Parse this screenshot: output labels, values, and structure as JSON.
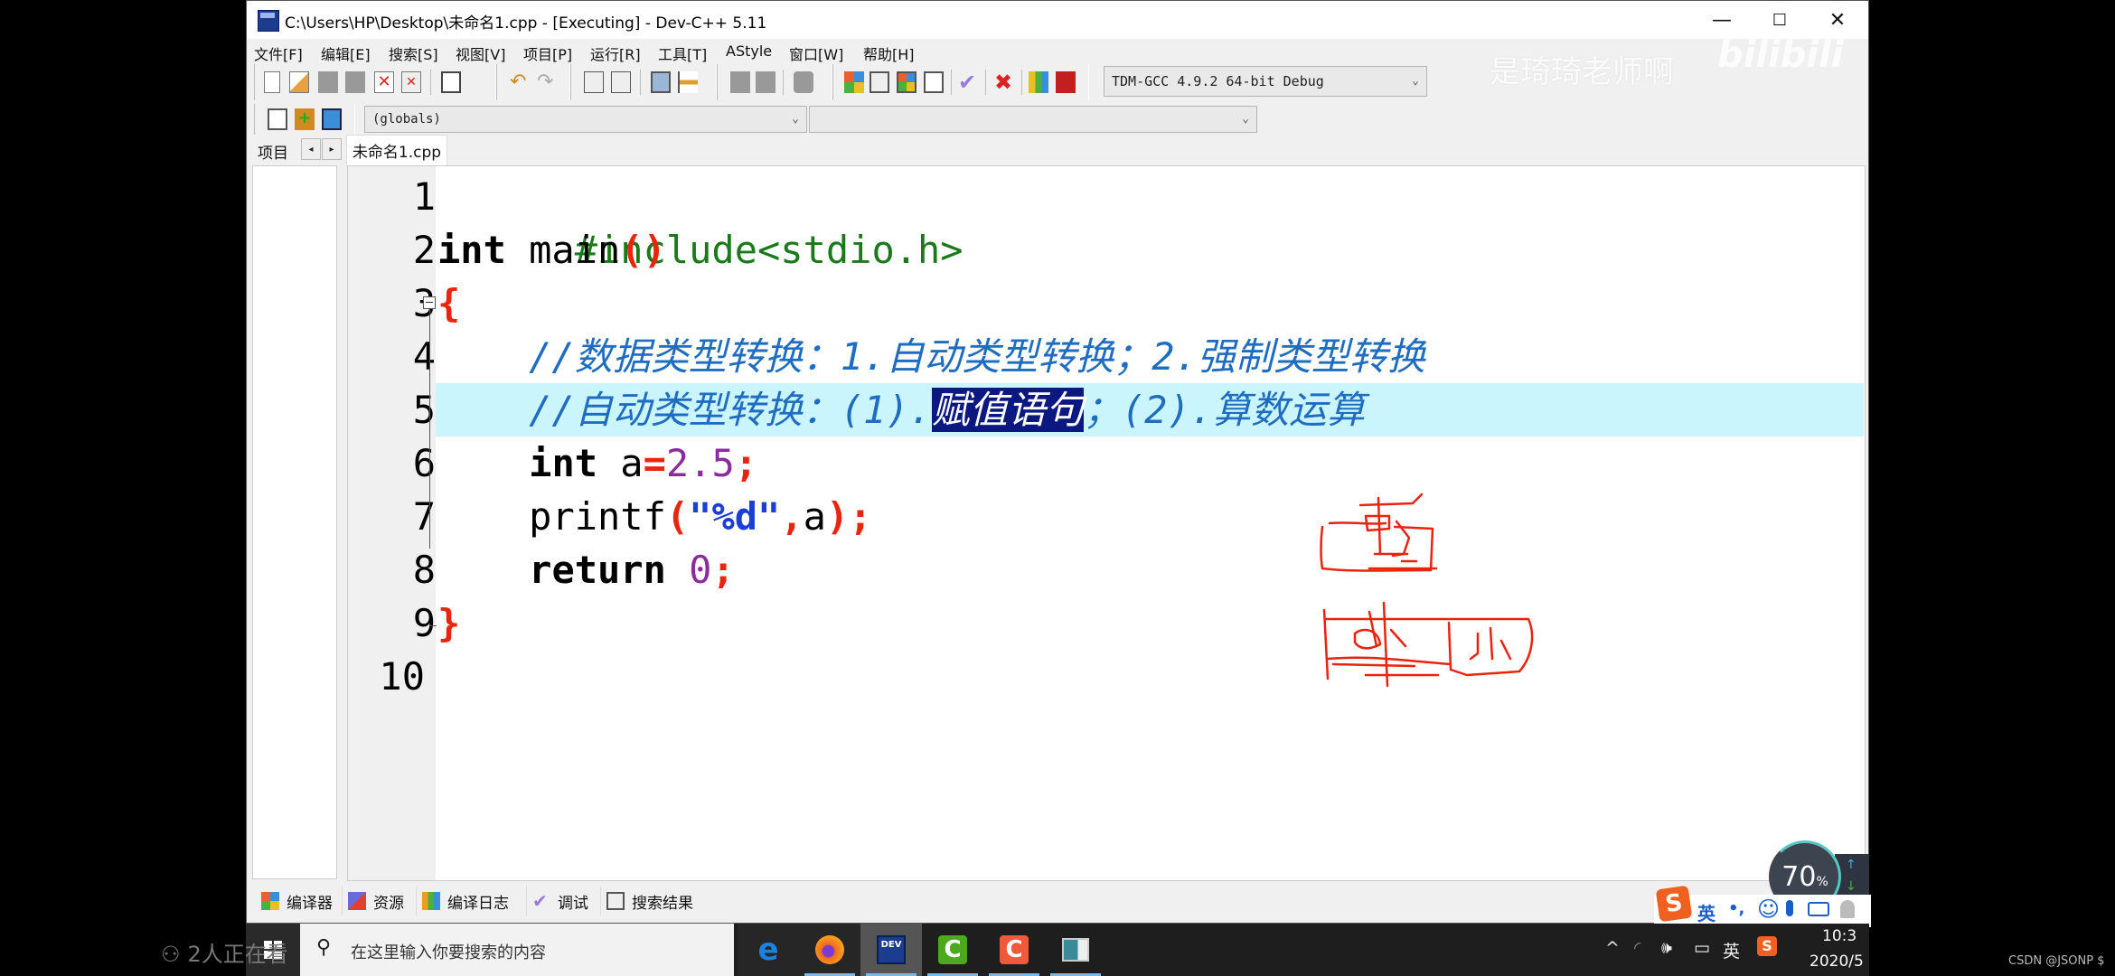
{
  "window": {
    "title": "C:\\Users\\HP\\Desktop\\未命名1.cpp - [Executing] - Dev-C++ 5.11",
    "controls": {
      "minimize": "—",
      "maximize": "☐",
      "close": "✕"
    }
  },
  "menu": [
    "文件[F]",
    "编辑[E]",
    "搜索[S]",
    "视图[V]",
    "项目[P]",
    "运行[R]",
    "工具[T]",
    "AStyle",
    "窗口[W]",
    "帮助[H]"
  ],
  "toolbar": {
    "compiler_select": "TDM-GCC 4.9.2 64-bit Debug",
    "scope_select": "(globals)",
    "member_select": ""
  },
  "left_panel": {
    "tab_label": "项目",
    "prev": "◂",
    "next": "▸"
  },
  "editor": {
    "file_tab": "未命名1.cpp",
    "line_numbers": [
      "1",
      "2",
      "3",
      "4",
      "5",
      "6",
      "7",
      "8",
      "9",
      "10"
    ],
    "highlighted_line": 5,
    "lines": {
      "l1": {
        "pp": "#include<stdio.h>"
      },
      "l2": {
        "kw": "int",
        "name": " main",
        "paren": "()"
      },
      "l3": {
        "brace": "{"
      },
      "l4": {
        "comment": "    //数据类型转换：1.自动类型转换；2.强制类型转换"
      },
      "l5": {
        "comment_a": "    //自动类型转换：(1).",
        "selected": "赋值语句",
        "comment_b": "；(2).算数运算"
      },
      "l6": {
        "indent": "    ",
        "kw": "int",
        "var": " a",
        "op": "=",
        "num": "2.5",
        "semi": ";"
      },
      "l7": {
        "indent": "    ",
        "fn": "printf",
        "lp": "(",
        "str": "\"%d\"",
        "comma": ",",
        "arg": "a",
        "rp": ")",
        "semi": ";"
      },
      "l8": {
        "indent": "    ",
        "kw": "return",
        "sp": " ",
        "num": "0",
        "semi": ";"
      },
      "l9": {
        "brace": "}"
      }
    }
  },
  "bottom_tabs": [
    "编译器",
    "资源",
    "编译日志",
    "调试",
    "搜索结果"
  ],
  "overlay": {
    "watermark": "是琦琦老师啊",
    "watermark_logo": "bilibili",
    "viewers": "2人正在看",
    "gauge_value": "70",
    "gauge_unit": "%",
    "csdn": "CSDN @JSONP $"
  },
  "ime": {
    "lang": "英",
    "punct": "•,",
    "items": [
      "☺",
      "🎤",
      "⌨"
    ]
  },
  "taskbar": {
    "search_placeholder": "在这里输入你要搜索的内容",
    "apps": [
      "edge",
      "firefox",
      "dev-cpp",
      "camtasia-green",
      "camtasia-orange",
      "window-app"
    ],
    "active_app": "dev-cpp",
    "tray_lang": "英",
    "time": "10:3",
    "date": "2020/5"
  },
  "colors": {
    "highlight_line": "#caf5fc",
    "selection": "#0a1880",
    "preprocessor": "#1a7a1a",
    "symbol": "#e8260e",
    "number": "#8a2ca0",
    "string": "#1a3ed6",
    "comment": "#1e6dc0",
    "handwriting": "#e8230e"
  }
}
